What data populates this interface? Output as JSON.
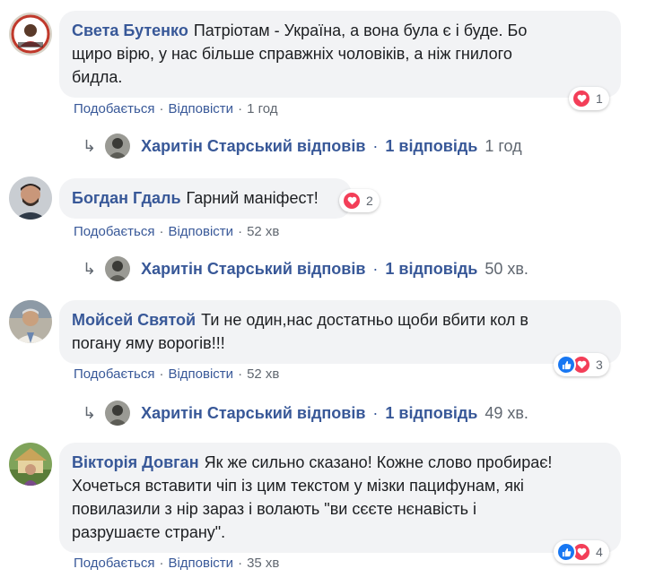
{
  "comments": [
    {
      "author": "Света Бутенко",
      "text_lines": [
        "Патріотам - Україна, а вона була є і буде. Бо",
        "щиро вірю, у нас більше справжніх чоловіків, а ніж гнилого",
        "бидла."
      ],
      "like_label": "Подобається",
      "reply_label": "Відповісти",
      "time": "1 год",
      "reactions": {
        "types": [
          "heart"
        ],
        "count": "1"
      },
      "reply": {
        "name": "Харитін Старський відповів",
        "count": "1 відповідь",
        "time": "1 год"
      }
    },
    {
      "author": "Богдан Гдаль",
      "text_lines": [
        "Гарний маніфест!"
      ],
      "like_label": "Подобається",
      "reply_label": "Відповісти",
      "time": "52 хв",
      "reactions": {
        "types": [
          "heart"
        ],
        "count": "2"
      },
      "reply": {
        "name": "Харитін Старський відповів",
        "count": "1 відповідь",
        "time": "50 хв."
      }
    },
    {
      "author": "Мойсей Святой",
      "text_lines": [
        "Ти не один,нас достатньо щоби вбити кол в",
        "погану яму ворогів!!!"
      ],
      "like_label": "Подобається",
      "reply_label": "Відповісти",
      "time": "52 хв",
      "reactions": {
        "types": [
          "like",
          "heart"
        ],
        "count": "3"
      },
      "reply": {
        "name": "Харитін Старський відповів",
        "count": "1 відповідь",
        "time": "49 хв."
      }
    },
    {
      "author": "Вікторія Довган",
      "text_lines": [
        "Як же сильно сказано! Кожне слово пробирає!",
        "Хочеться вставити чіп із цим текстом у мізки пацифунам, які",
        "повилазили з нір зараз і волають \"ви сєєте нєнавість і",
        "разрушаєте страну\"."
      ],
      "like_label": "Подобається",
      "reply_label": "Відповісти",
      "time": "35 хв",
      "reactions": {
        "types": [
          "like",
          "heart"
        ],
        "count": "4"
      }
    }
  ],
  "separator": "·",
  "reply_arrow": "↳"
}
